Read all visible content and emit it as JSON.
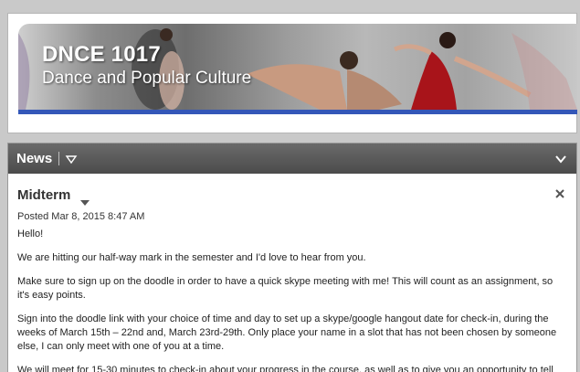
{
  "banner": {
    "course_code": "DNCE 1017",
    "course_name": "Dance and Popular Culture"
  },
  "news": {
    "title": "News",
    "item": {
      "title": "Midterm",
      "posted": "Posted Mar 8, 2015 8:47 AM",
      "paragraphs": [
        "Hello!",
        "We are hitting our half-way mark in the semester and I'd love to hear from you.",
        "Make sure to sign up on the doodle in order to have a quick skype meeting with me!  This will count as an assignment, so it's easy points.",
        "Sign into the doodle link with your choice of time and day to set up a skype/google hangout date for check-in, during the weeks of March 15th – 22nd and, March 23rd-29th.  Only place your name in a slot that has not been chosen by someone else, I can only meet with one of you at a time.",
        "We will meet for 15-30 minutes to check-in about your progress in the course, as well as to give you an opportunity to tell"
      ]
    }
  },
  "colors": {
    "banner_bar": "#3457b8",
    "news_header": "#555555"
  },
  "icons": [
    "menu-caret-icon",
    "collapse-chevron-icon",
    "item-caret-icon",
    "close-icon"
  ]
}
